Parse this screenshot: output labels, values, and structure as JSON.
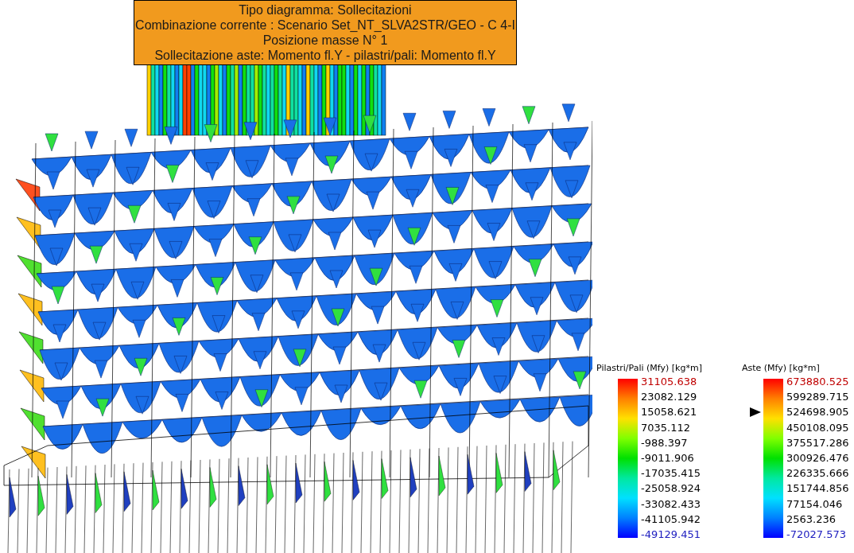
{
  "info_box": {
    "lines": [
      "Tipo diagramma: Sollecitazioni",
      "Combinazione corrente : Scenario Set_NT_SLVA2STR/GEO - C 4-I",
      "Posizione masse N° 1",
      "Sollecitazione aste: Momento fl.Y - pilastri/pali: Momento fl.Y"
    ]
  },
  "legends": [
    {
      "title": "Pilastri/Pali (Mfy) [kg*m]",
      "ticks": [
        {
          "label": "31105.638",
          "marked": false
        },
        {
          "label": "23082.129",
          "marked": false
        },
        {
          "label": "15058.621",
          "marked": false
        },
        {
          "label": "7035.112",
          "marked": false
        },
        {
          "label": "-988.397",
          "marked": false
        },
        {
          "label": "-9011.906",
          "marked": false
        },
        {
          "label": "-17035.415",
          "marked": false
        },
        {
          "label": "-25058.924",
          "marked": false
        },
        {
          "label": "-33082.433",
          "marked": false
        },
        {
          "label": "-41105.942",
          "marked": false
        },
        {
          "label": "-49129.451",
          "marked": false
        }
      ]
    },
    {
      "title": "Aste (Mfy) [kg*m]",
      "ticks": [
        {
          "label": "673880.525",
          "marked": false
        },
        {
          "label": "599289.715",
          "marked": false
        },
        {
          "label": "524698.905",
          "marked": true
        },
        {
          "label": "450108.095",
          "marked": false
        },
        {
          "label": "375517.286",
          "marked": false
        },
        {
          "label": "300926.476",
          "marked": false
        },
        {
          "label": "226335.666",
          "marked": false
        },
        {
          "label": "151744.856",
          "marked": false
        },
        {
          "label": "77154.046",
          "marked": false
        },
        {
          "label": "2563.236",
          "marked": false
        },
        {
          "label": "-72027.573",
          "marked": false
        }
      ]
    }
  ]
}
